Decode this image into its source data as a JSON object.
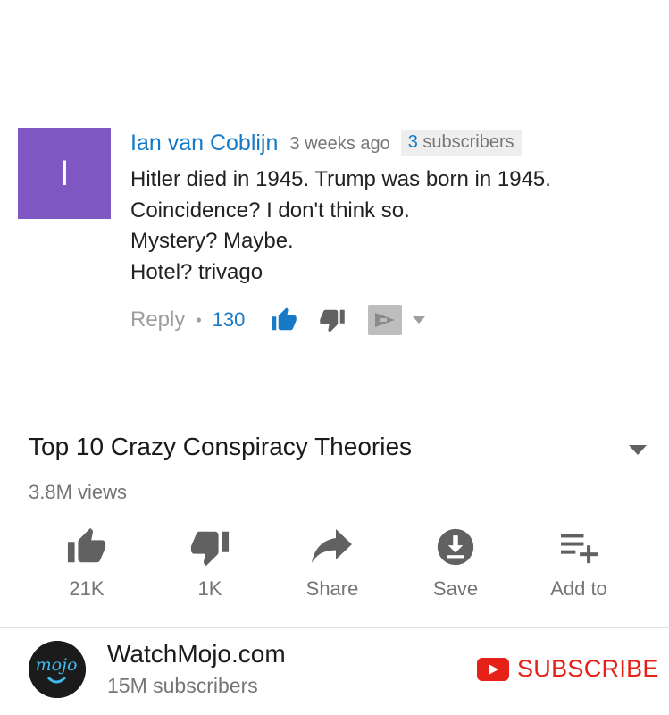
{
  "comment": {
    "avatar_letter": "I",
    "avatar_color": "#7e57c2",
    "author": "Ian van Coblijn",
    "time": "3 weeks ago",
    "subscriber_count": "3",
    "subscriber_suffix": " subscribers",
    "lines": [
      "Hitler died in 1945. Trump was born in 1945.",
      "Coincidence? I don't think so.",
      "Mystery? Maybe.",
      "Hotel? trivago"
    ],
    "reply_label": "Reply",
    "separator": "•",
    "like_count": "130",
    "icons": [
      "thumbs-up-icon",
      "thumbs-down-icon",
      "flag-icon",
      "caret-down-icon"
    ]
  },
  "video": {
    "title": "Top 10 Crazy Conspiracy Theories",
    "views": "3.8M views",
    "actions": [
      {
        "icon": "thumbs-up-icon",
        "label": "21K"
      },
      {
        "icon": "thumbs-down-icon",
        "label": "1K"
      },
      {
        "icon": "share-icon",
        "label": "Share"
      },
      {
        "icon": "download-icon",
        "label": "Save"
      },
      {
        "icon": "playlist-add-icon",
        "label": "Add to"
      }
    ]
  },
  "channel": {
    "name": "WatchMojo.com",
    "subscribers": "15M subscribers",
    "logo_text": "mojo",
    "subscribe_label": "SUBSCRIBE",
    "subscribe_color": "#e62117"
  },
  "colors": {
    "link_blue": "#167ac6",
    "muted_gray": "#757575",
    "icon_gray": "#616161"
  }
}
